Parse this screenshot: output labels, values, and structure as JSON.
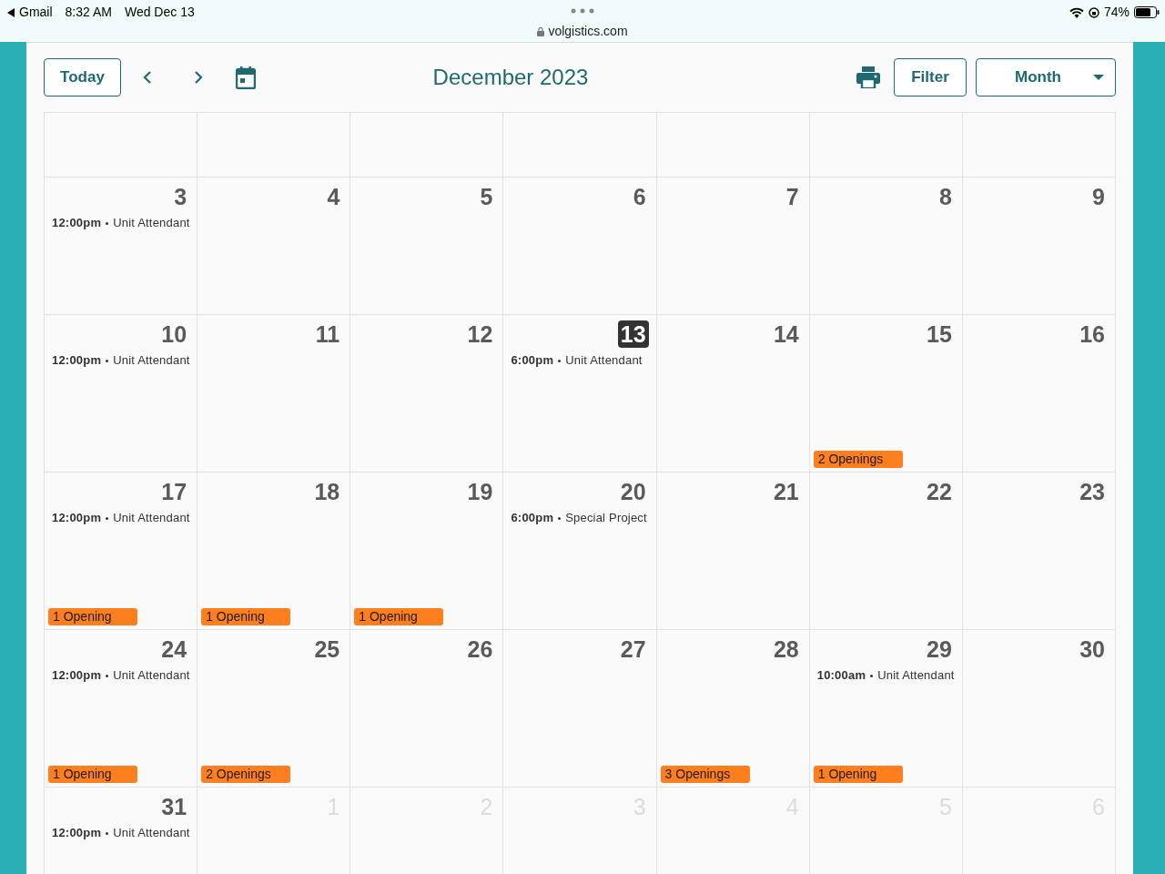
{
  "status_bar": {
    "back_app": "Gmail",
    "time": "8:32 AM",
    "date": "Wed Dec 13",
    "url": "volgistics.com",
    "battery": "74%"
  },
  "toolbar": {
    "today_button": "Today",
    "title": "December 2023",
    "filter_button": "Filter",
    "view_select": "Month"
  },
  "weeks": [
    {
      "days": [
        {
          "day": "3",
          "outside_month": false,
          "today": false,
          "events": [
            {
              "time": "12:00pm",
              "title": "Unit Attendant"
            }
          ]
        },
        {
          "day": "4",
          "outside_month": false,
          "today": false
        },
        {
          "day": "5",
          "outside_month": false,
          "today": false
        },
        {
          "day": "6",
          "outside_month": false,
          "today": false
        },
        {
          "day": "7",
          "outside_month": false,
          "today": false
        },
        {
          "day": "8",
          "outside_month": false,
          "today": false
        },
        {
          "day": "9",
          "outside_month": false,
          "today": false
        }
      ]
    },
    {
      "days": [
        {
          "day": "10",
          "outside_month": false,
          "today": false,
          "events": [
            {
              "time": "12:00pm",
              "title": "Unit Attendant"
            }
          ]
        },
        {
          "day": "11",
          "outside_month": false,
          "today": false
        },
        {
          "day": "12",
          "outside_month": false,
          "today": false
        },
        {
          "day": "13",
          "outside_month": false,
          "today": true,
          "events": [
            {
              "time": "6:00pm",
              "title": "Unit Attendant"
            }
          ]
        },
        {
          "day": "14",
          "outside_month": false,
          "today": false
        },
        {
          "day": "15",
          "outside_month": false,
          "today": false,
          "openings": "2 Openings"
        },
        {
          "day": "16",
          "outside_month": false,
          "today": false
        }
      ]
    },
    {
      "days": [
        {
          "day": "17",
          "outside_month": false,
          "today": false,
          "events": [
            {
              "time": "12:00pm",
              "title": "Unit Attendant"
            }
          ],
          "openings": "1 Opening"
        },
        {
          "day": "18",
          "outside_month": false,
          "today": false,
          "openings": "1 Opening"
        },
        {
          "day": "19",
          "outside_month": false,
          "today": false,
          "openings": "1 Opening"
        },
        {
          "day": "20",
          "outside_month": false,
          "today": false,
          "events": [
            {
              "time": "6:00pm",
              "title": "Special Project"
            }
          ]
        },
        {
          "day": "21",
          "outside_month": false,
          "today": false
        },
        {
          "day": "22",
          "outside_month": false,
          "today": false
        },
        {
          "day": "23",
          "outside_month": false,
          "today": false
        }
      ]
    },
    {
      "days": [
        {
          "day": "24",
          "outside_month": false,
          "today": false,
          "events": [
            {
              "time": "12:00pm",
              "title": "Unit Attendant"
            }
          ],
          "openings": "1 Opening"
        },
        {
          "day": "25",
          "outside_month": false,
          "today": false,
          "openings": "2 Openings"
        },
        {
          "day": "26",
          "outside_month": false,
          "today": false
        },
        {
          "day": "27",
          "outside_month": false,
          "today": false
        },
        {
          "day": "28",
          "outside_month": false,
          "today": false,
          "openings": "3 Openings"
        },
        {
          "day": "29",
          "outside_month": false,
          "today": false,
          "events": [
            {
              "time": "10:00am",
              "title": "Unit Attendant"
            }
          ],
          "openings": "1 Opening"
        },
        {
          "day": "30",
          "outside_month": false,
          "today": false
        }
      ]
    },
    {
      "days": [
        {
          "day": "31",
          "outside_month": false,
          "today": false,
          "events": [
            {
              "time": "12:00pm",
              "title": "Unit Attendant"
            }
          ]
        },
        {
          "day": "1",
          "outside_month": true,
          "today": false
        },
        {
          "day": "2",
          "outside_month": true,
          "today": false
        },
        {
          "day": "3",
          "outside_month": true,
          "today": false
        },
        {
          "day": "4",
          "outside_month": true,
          "today": false
        },
        {
          "day": "5",
          "outside_month": true,
          "today": false
        },
        {
          "day": "6",
          "outside_month": true,
          "today": false
        }
      ]
    }
  ]
}
